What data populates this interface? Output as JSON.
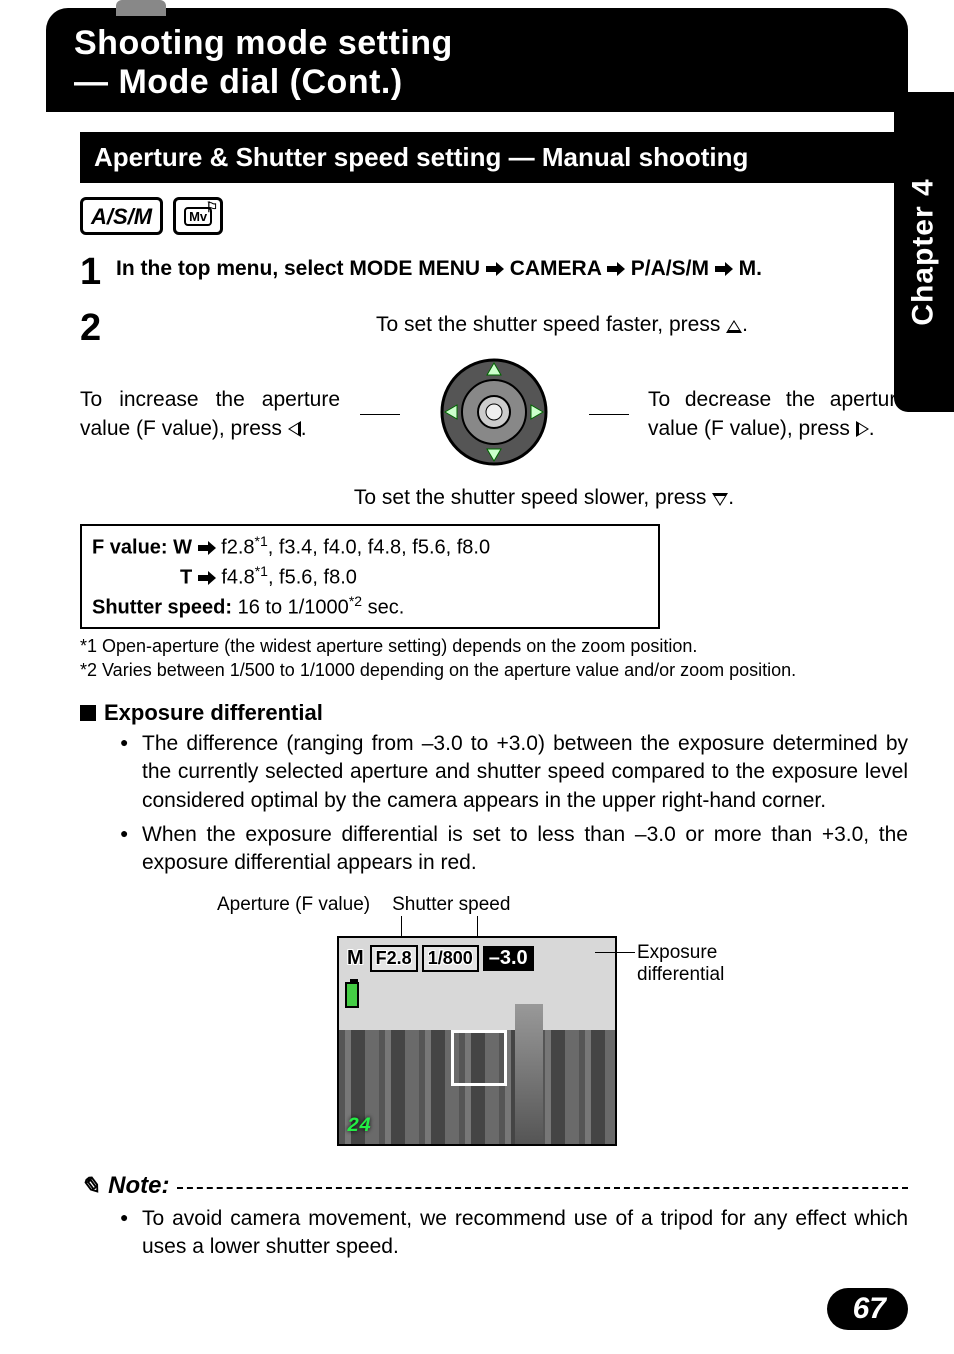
{
  "sideTab": "Chapter 4",
  "header": {
    "line1": "Shooting mode setting",
    "line2": "— Mode dial (Cont.)"
  },
  "section": "Aperture & Shutter speed setting — Manual shooting",
  "modeBoxLabel": "A/S/M",
  "modeMyLabel": "Mv",
  "step1": {
    "num": "1",
    "prefix": "In the top menu, select MODE MENU ",
    "p1": " CAMERA ",
    "p2": " P/A/S/M ",
    "p3": " M."
  },
  "step2": {
    "num": "2",
    "top_a": "To set the shutter speed faster, press ",
    "top_b": ".",
    "left_a": "To increase the aperture value (F value), press ",
    "left_b": ".",
    "right_a": "To decrease the aperture value (F value), press ",
    "right_b": ".",
    "bottom_a": "To set the shutter speed slower, press ",
    "bottom_b": "."
  },
  "valuesBox": {
    "l1a": "F value: W ",
    "l1b": " f2.8",
    "l1sup": "*1",
    "l1c": ", f3.4, f4.0, f4.8, f5.6, f8.0",
    "l2a": "T ",
    "l2b": " f4.8",
    "l2sup": "*1",
    "l2c": ", f5.6, f8.0",
    "l3a": "Shutter speed:",
    "l3b": "  16 to 1/1000",
    "l3sup": "*2",
    "l3c": " sec."
  },
  "footnotes": {
    "f1": "*1  Open-aperture (the widest aperture setting) depends on the zoom position.",
    "f2": "*2  Varies between 1/500 to 1/1000 depending on the aperture value and/or zoom position."
  },
  "subhead": "Exposure differential",
  "bullets": [
    "The difference (ranging from –3.0 to +3.0) between the exposure determined by the currently selected aperture and shutter speed compared to the exposure level considered optimal by the camera appears in the upper right-hand corner.",
    "When the exposure differential is set to less than –3.0 or more than +3.0, the exposure differential appears in red."
  ],
  "figure": {
    "apertureLabel": "Aperture (F value)",
    "shutterLabel": "Shutter speed",
    "expLabel1": "Exposure",
    "expLabel2": "differential",
    "osd": {
      "mode": "M",
      "f": "F2.8",
      "shutter": "1/800",
      "diff": "–3.0",
      "count": "24"
    }
  },
  "note": {
    "label": "Note:",
    "bullet": "To avoid camera movement, we recommend use of a tripod for any effect which uses a lower shutter speed."
  },
  "pageNum": "67"
}
